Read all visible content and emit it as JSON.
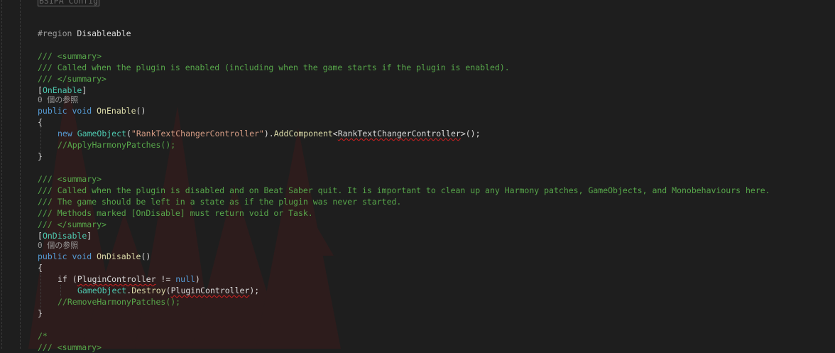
{
  "code": {
    "top_fragment": "BSIPA Config",
    "region": {
      "keyword": "#region",
      "name": "Disableable"
    },
    "enable_summary": {
      "open": "/// <summary>",
      "text": "/// Called when the plugin is enabled (including when the game starts if the plugin is enabled).",
      "close": "/// </summary>"
    },
    "enable_attribute": {
      "open": "[",
      "name": "OnEnable",
      "close": "]"
    },
    "enable_refs": "0 個の参照",
    "enable_sig": {
      "k1": "public",
      "k2": "void",
      "name": "OnEnable",
      "parens": "()"
    },
    "enable_open_brace": "{",
    "enable_body1": {
      "new": "new",
      "type": "GameObject",
      "paren": "(",
      "str": "\"RankTextChangerController\"",
      "mid": ").",
      "method": "AddComponent",
      "lt": "<",
      "generic": "RankTextChangerController",
      "end": ">();"
    },
    "enable_body2": "//ApplyHarmonyPatches();",
    "enable_close_brace": "}",
    "disable_summary": {
      "open": "/// <summary>",
      "l1": "/// Called when the plugin is disabled and on Beat Saber quit. It is important to clean up any Harmony patches, GameObjects, and Monobehaviours here.",
      "l2": "/// The game should be left in a state as if the plugin was never started.",
      "l3": "/// Methods marked [OnDisable] must return void or Task.",
      "close": "/// </summary>"
    },
    "disable_attribute": {
      "open": "[",
      "name": "OnDisable",
      "close": "]"
    },
    "disable_refs": "0 個の参照",
    "disable_sig": {
      "k1": "public",
      "k2": "void",
      "name": "OnDisable",
      "parens": "()"
    },
    "disable_open_brace": "{",
    "disable_if": {
      "kw": "if",
      "open": " (",
      "var": "PluginController",
      "op": " != ",
      "null": "null",
      "close": ")"
    },
    "disable_destroy": {
      "type": "GameObject",
      "dot": ".",
      "method": "Destroy",
      "open": "(",
      "var": "PluginController",
      "close": ");"
    },
    "disable_remove": "//RemoveHarmonyPatches();",
    "disable_close_brace": "}",
    "tail_comment": "/*",
    "tail_summary": "/// <summary>"
  },
  "colors": {
    "background": "#1e1e1e",
    "comment": "#57a64a",
    "keyword": "#569cd6",
    "type": "#4ec9b0",
    "string": "#d69d85",
    "method": "#dcdcaa"
  }
}
